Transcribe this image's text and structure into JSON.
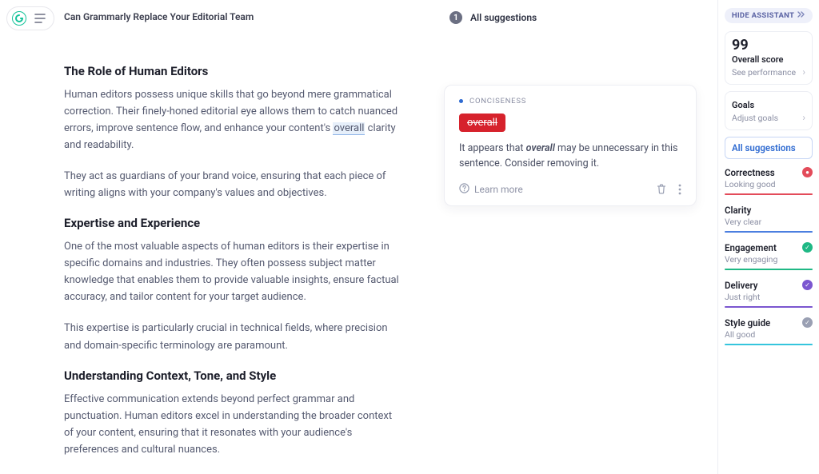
{
  "header": {
    "doc_title": "Can Grammarly Replace Your Editorial Team",
    "suggestions_label": "All suggestions",
    "suggestions_count": "1"
  },
  "editor": {
    "h1": "The Role of Human Editors",
    "p1a": "Human editors possess unique skills that go beyond mere grammatical correction. Their finely-honed editorial eye allows them to catch nuanced errors, improve sentence flow, and enhance your content's ",
    "p1_word": "overall",
    "p1b": " clarity and readability.",
    "p2": "They act as guardians of your brand voice, ensuring that each piece of writing aligns with your company's values and objectives.",
    "h2": "Expertise and Experience",
    "p3": "One of the most valuable aspects of human editors is their expertise in specific domains and industries. They often possess subject matter knowledge that enables them to provide valuable insights, ensure factual accuracy, and tailor content for your target audience.",
    "p4": "This expertise is particularly crucial in technical fields, where precision and domain-specific terminology are paramount.",
    "h3": "Understanding Context, Tone, and Style",
    "p5": "Effective communication extends beyond perfect grammar and punctuation. Human editors excel in understanding the broader context of your content, ensuring that it resonates with your audience's preferences and cultural nuances."
  },
  "card": {
    "category": "CONCISENESS",
    "chip": "overall",
    "msg_a": "It appears that ",
    "msg_word": "overall",
    "msg_b": " may be unnecessary in this sentence. Consider removing it.",
    "learn_more": "Learn more"
  },
  "rail": {
    "hide": "HIDE ASSISTANT",
    "score": "99",
    "score_label": "Overall score",
    "score_sub": "See performance",
    "goals_label": "Goals",
    "goals_sub": "Adjust goals",
    "all_sugg": "All suggestions",
    "metrics": [
      {
        "name": "Correctness",
        "status": "Looking good",
        "badge": "red",
        "fill": "fill-red"
      },
      {
        "name": "Clarity",
        "status": "Very clear",
        "badge": "",
        "fill": "fill-blue"
      },
      {
        "name": "Engagement",
        "status": "Very engaging",
        "badge": "green",
        "fill": "fill-green"
      },
      {
        "name": "Delivery",
        "status": "Just right",
        "badge": "purple",
        "fill": "fill-purple"
      },
      {
        "name": "Style guide",
        "status": "All good",
        "badge": "grey",
        "fill": "fill-teal"
      }
    ]
  }
}
